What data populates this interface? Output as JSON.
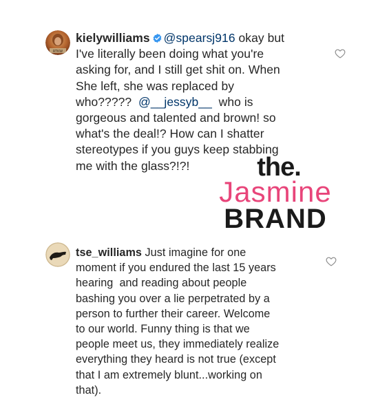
{
  "comments": [
    {
      "username": "kielywilliams",
      "verified": true,
      "lines": [
        {
          "mention": "@spearsj916",
          "text": " okay but"
        },
        {
          "text": "I've literally been doing what you're"
        },
        {
          "text": "asking for, and I still get shit on. When"
        },
        {
          "text": "She left, she was replaced by"
        },
        {
          "pre": "who?????  ",
          "mention": "@__jessyb__",
          "text": "  who is"
        },
        {
          "text": "gorgeous and talented and brown! so"
        },
        {
          "text": "what's the deal!? How can I shatter"
        },
        {
          "text": "stereotypes if you guys keep stabbing"
        },
        {
          "text": "me with the glass?!?!"
        }
      ],
      "avatar_icon": "profile-photo",
      "like_icon": "heart-outline-icon"
    },
    {
      "username": "tse_williams",
      "verified": false,
      "lines": [
        {
          "text": " Just imagine for one"
        },
        {
          "text": "moment if you endured the last 15 years"
        },
        {
          "text": "hearing  and reading about people"
        },
        {
          "text": "bashing you over a lie perpetrated by a"
        },
        {
          "text": "person to further their career. Welcome"
        },
        {
          "text": "to our world. Funny thing is that we"
        },
        {
          "text": "people meet us, they immediately realize"
        },
        {
          "text": "everything they heard is not true (except"
        },
        {
          "text": "that I am extremely blunt...working on"
        },
        {
          "text": "that)."
        }
      ],
      "avatar_icon": "profile-photo",
      "like_icon": "heart-outline-icon"
    }
  ],
  "watermark": {
    "line1": "the.",
    "line2": "Jasmine",
    "line3": "BRAND"
  },
  "colors": {
    "text": "#262626",
    "mention": "#003569",
    "verified": "#3897f0",
    "watermark_pink": "#e8457a"
  }
}
